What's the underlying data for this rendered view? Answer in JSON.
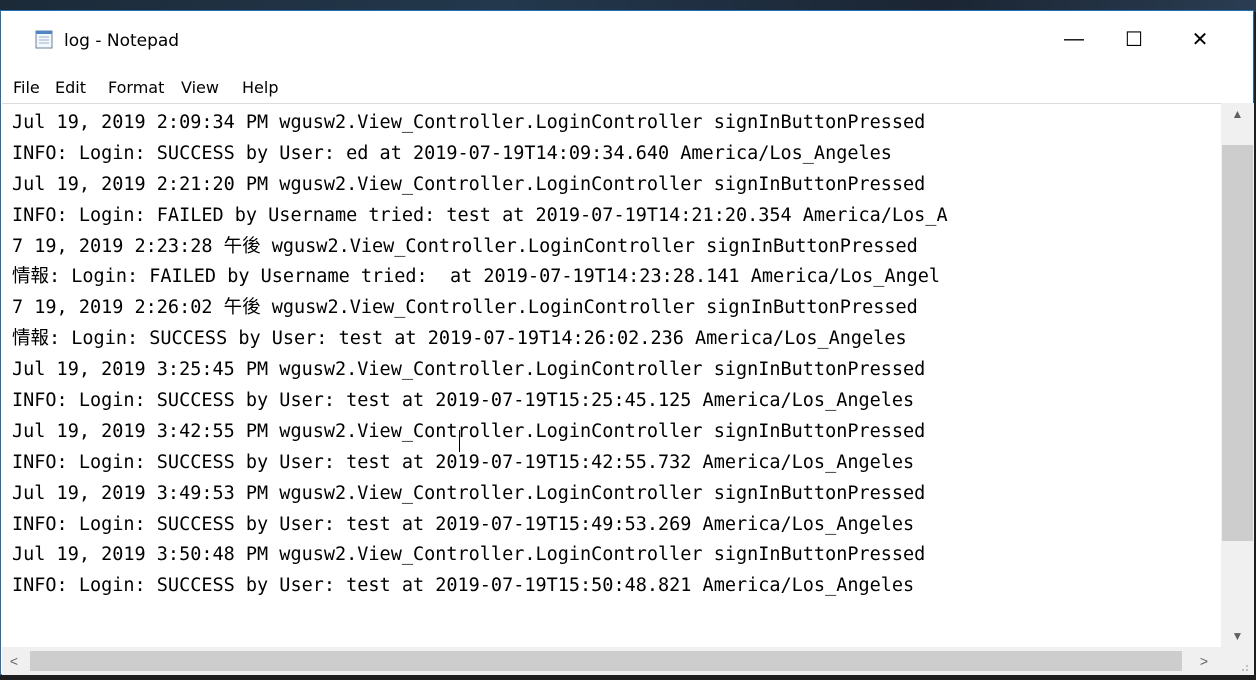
{
  "window": {
    "title": "log - Notepad",
    "controls": {
      "minimize": "—",
      "maximize": "☐",
      "close": "✕"
    }
  },
  "menu": [
    "File",
    "Edit",
    "Format",
    "View",
    "Help"
  ],
  "document": {
    "lines": [
      "Jul 19, 2019 2:09:34 PM wgusw2.View_Controller.LoginController signInButtonPressed",
      "INFO: Login: SUCCESS by User: ed at 2019-07-19T14:09:34.640 America/Los_Angeles",
      "Jul 19, 2019 2:21:20 PM wgusw2.View_Controller.LoginController signInButtonPressed",
      "INFO: Login: FAILED by Username tried: test at 2019-07-19T14:21:20.354 America/Los_A",
      "7 19, 2019 2:23:28 午後 wgusw2.View_Controller.LoginController signInButtonPressed",
      "情報: Login: FAILED by Username tried:  at 2019-07-19T14:23:28.141 America/Los_Angel",
      "7 19, 2019 2:26:02 午後 wgusw2.View_Controller.LoginController signInButtonPressed",
      "情報: Login: SUCCESS by User: test at 2019-07-19T14:26:02.236 America/Los_Angeles",
      "Jul 19, 2019 3:25:45 PM wgusw2.View_Controller.LoginController signInButtonPressed",
      "INFO: Login: SUCCESS by User: test at 2019-07-19T15:25:45.125 America/Los_Angeles",
      "Jul 19, 2019 3:42:55 PM wgusw2.View_Controller.LoginController signInButtonPressed",
      "INFO: Login: SUCCESS by User: test at 2019-07-19T15:42:55.732 America/Los_Angeles",
      "Jul 19, 2019 3:49:53 PM wgusw2.View_Controller.LoginController signInButtonPressed",
      "INFO: Login: SUCCESS by User: test at 2019-07-19T15:49:53.269 America/Los_Angeles",
      "Jul 19, 2019 3:50:48 PM wgusw2.View_Controller.LoginController signInButtonPressed",
      "INFO: Login: SUCCESS by User: test at 2019-07-19T15:50:48.821 America/Los_Angeles"
    ]
  },
  "scrollbars": {
    "vertical": {
      "up_arrow": "▲",
      "down_arrow": "▼"
    },
    "horizontal": {
      "left_arrow": "<",
      "right_arrow": ">"
    }
  },
  "icons": {
    "app": "notepad-icon",
    "minimize": "minimize-icon",
    "maximize": "maximize-icon",
    "close": "close-icon"
  }
}
